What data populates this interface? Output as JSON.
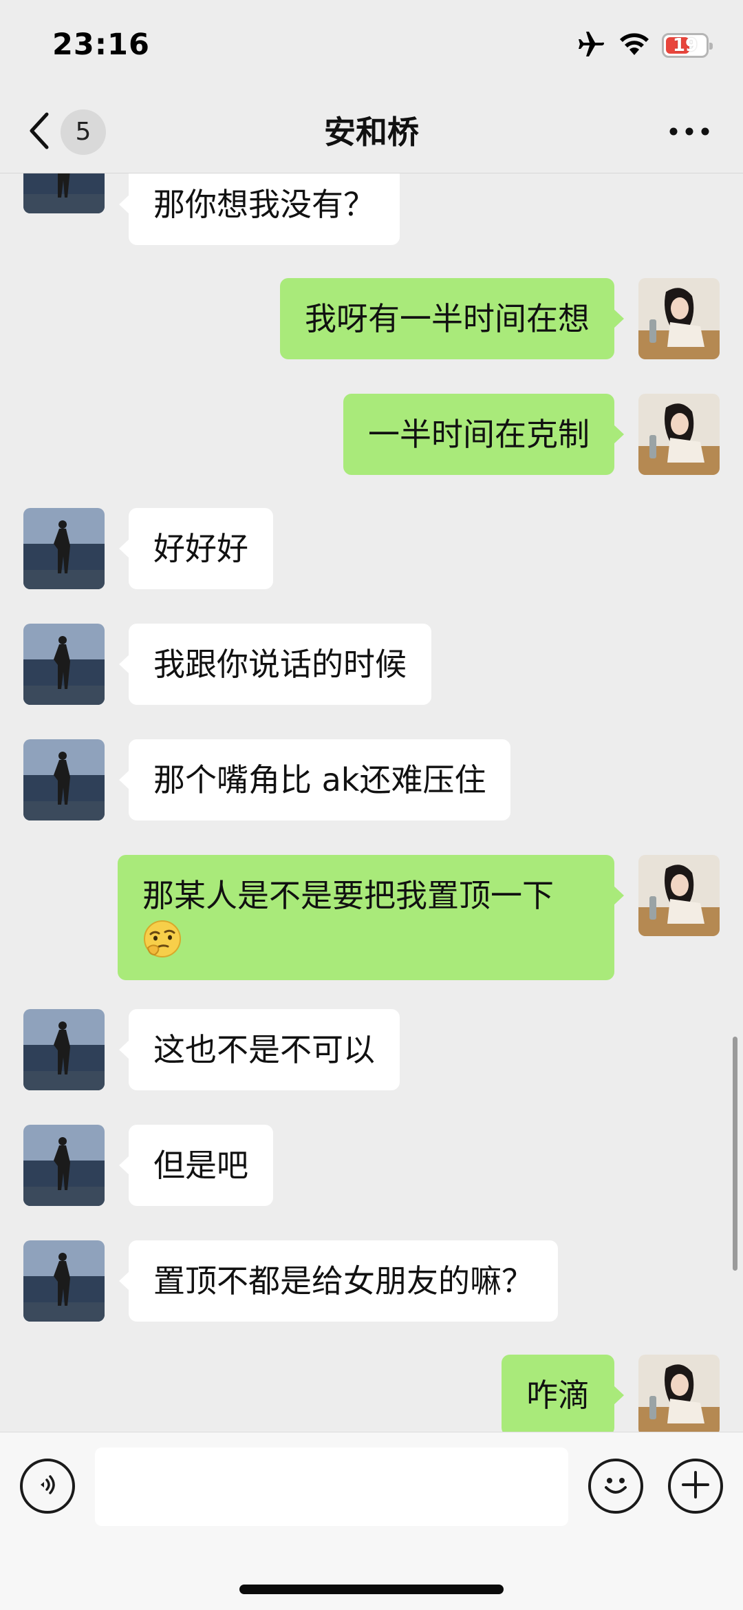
{
  "status_bar": {
    "time": "23:16",
    "battery_level": "19"
  },
  "header": {
    "back_badge": "5",
    "title": "安和桥"
  },
  "messages": [
    {
      "side": "in",
      "text": "那你想我没有？"
    },
    {
      "side": "out",
      "text": "我呀有一半时间在想"
    },
    {
      "side": "out",
      "text": "一半时间在克制"
    },
    {
      "side": "in",
      "text": "好好好"
    },
    {
      "side": "in",
      "text": "我跟你说话的时候"
    },
    {
      "side": "in",
      "text": "那个嘴角比 ak还难压住"
    },
    {
      "side": "out",
      "text": "那某人是不是要把我置顶一下",
      "emoji": "thinking-emoji"
    },
    {
      "side": "in",
      "text": "这也不是不可以"
    },
    {
      "side": "in",
      "text": "但是吧"
    },
    {
      "side": "in",
      "text": "置顶不都是给女朋友的嘛？"
    },
    {
      "side": "out",
      "text": "咋滴"
    }
  ],
  "input_bar": {
    "value": "",
    "placeholder": ""
  },
  "icons": {
    "airplane": "airplane-icon",
    "wifi": "wifi-icon",
    "battery": "battery-icon",
    "back": "chevron-left-icon",
    "more": "more-dots-icon",
    "voice": "voice-icon",
    "emoji": "emoji-icon",
    "plus": "plus-icon"
  },
  "colors": {
    "background": "#ededed",
    "outgoing_bubble": "#a9ea7a",
    "incoming_bubble": "#ffffff",
    "battery_low": "#e8453c"
  }
}
